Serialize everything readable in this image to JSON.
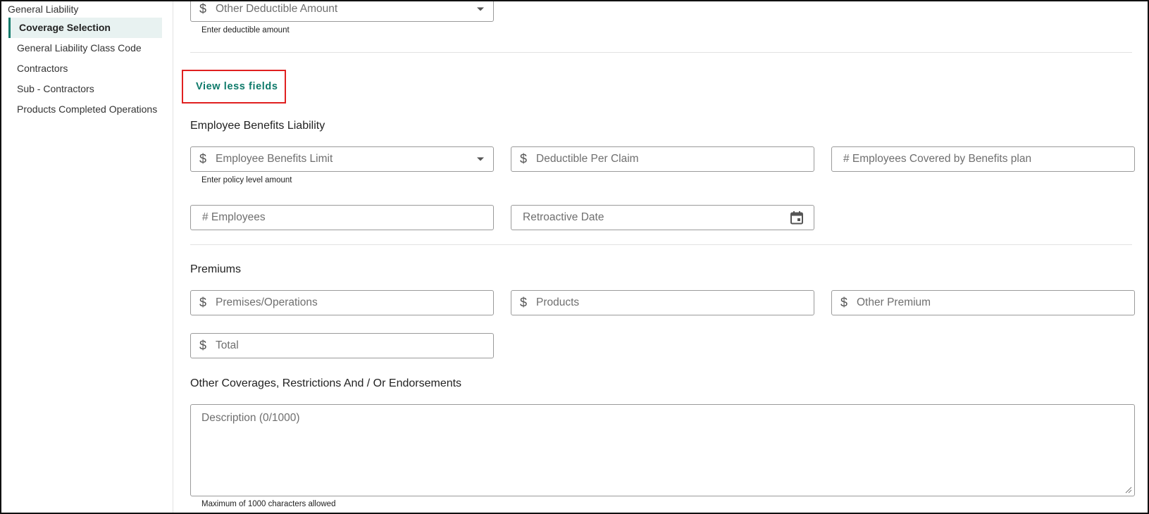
{
  "sidebar": {
    "section": "General Liability",
    "items": [
      {
        "label": "Coverage Selection",
        "active": true
      },
      {
        "label": "General Liability Class Code",
        "active": false
      },
      {
        "label": "Contractors",
        "active": false
      },
      {
        "label": "Sub - Contractors",
        "active": false
      },
      {
        "label": "Products Completed Operations",
        "active": false
      }
    ]
  },
  "top": {
    "other_deductible_placeholder": "Other Deductible Amount",
    "other_deductible_hint": "Enter deductible amount"
  },
  "view_less_label": "View less fields",
  "employee_benefits": {
    "title": "Employee Benefits Liability",
    "limit_placeholder": "Employee Benefits Limit",
    "limit_hint": "Enter policy level amount",
    "deductible_placeholder": "Deductible Per Claim",
    "employees_covered_placeholder": "# Employees Covered by Benefits plan",
    "employees_placeholder": "# Employees",
    "retro_date_placeholder": "Retroactive Date"
  },
  "premiums": {
    "title": "Premiums",
    "premises_placeholder": "Premises/Operations",
    "products_placeholder": "Products",
    "other_placeholder": "Other Premium",
    "total_placeholder": "Total"
  },
  "other_coverages": {
    "title": "Other Coverages, Restrictions And / Or Endorsements",
    "description_placeholder": "Description (0/1000)",
    "hint": "Maximum of 1000 characters allowed"
  },
  "currency_symbol": "$",
  "colors": {
    "accent": "#0e7a6a",
    "highlight_box": "#e02020"
  }
}
